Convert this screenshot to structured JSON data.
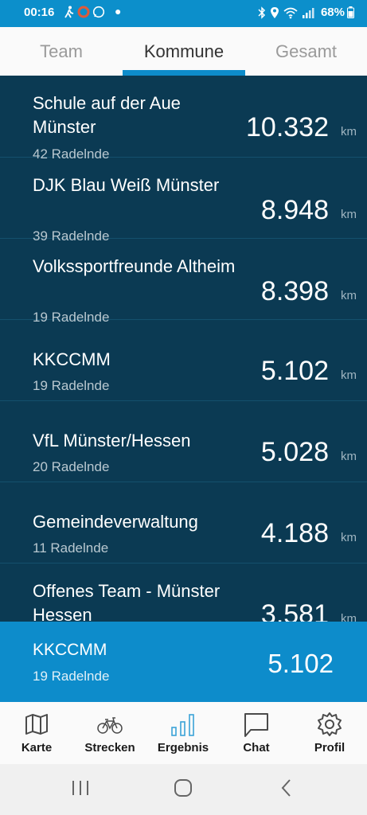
{
  "status": {
    "time": "00:16",
    "battery": "68%"
  },
  "tabs": [
    {
      "label": "Team"
    },
    {
      "label": "Kommune"
    },
    {
      "label": "Gesamt"
    }
  ],
  "rows": [
    {
      "name": "Schule auf der Aue Münster",
      "count": "42 Radelnde",
      "km": "10.332",
      "unit": "km"
    },
    {
      "name": "DJK Blau Weiß Münster",
      "count": "39 Radelnde",
      "km": "8.948",
      "unit": "km"
    },
    {
      "name": "Volkssportfreunde Altheim",
      "count": "19 Radelnde",
      "km": "8.398",
      "unit": "km"
    },
    {
      "name": "KKCCMM",
      "count": "19 Radelnde",
      "km": "5.102",
      "unit": "km"
    },
    {
      "name": "VfL Münster/Hessen",
      "count": "20 Radelnde",
      "km": "5.028",
      "unit": "km"
    },
    {
      "name": "Gemeindeverwaltung",
      "count": "11 Radelnde",
      "km": "4.188",
      "unit": "km"
    },
    {
      "name": "Offenes Team - Münster Hessen",
      "count": "",
      "km": "3.581",
      "unit": "km"
    }
  ],
  "selected": {
    "name": "KKCCMM",
    "count": "19 Radelnde",
    "km": "5.102"
  },
  "nav": [
    {
      "label": "Karte",
      "icon": "map-icon"
    },
    {
      "label": "Strecken",
      "icon": "bike-icon"
    },
    {
      "label": "Ergebnis",
      "icon": "bar-chart-icon"
    },
    {
      "label": "Chat",
      "icon": "chat-icon"
    },
    {
      "label": "Profil",
      "icon": "gear-icon"
    }
  ],
  "colors": {
    "accent": "#0d8ccb",
    "list_bg": "#0b3a53",
    "status_bar": "#0c8fcb"
  }
}
